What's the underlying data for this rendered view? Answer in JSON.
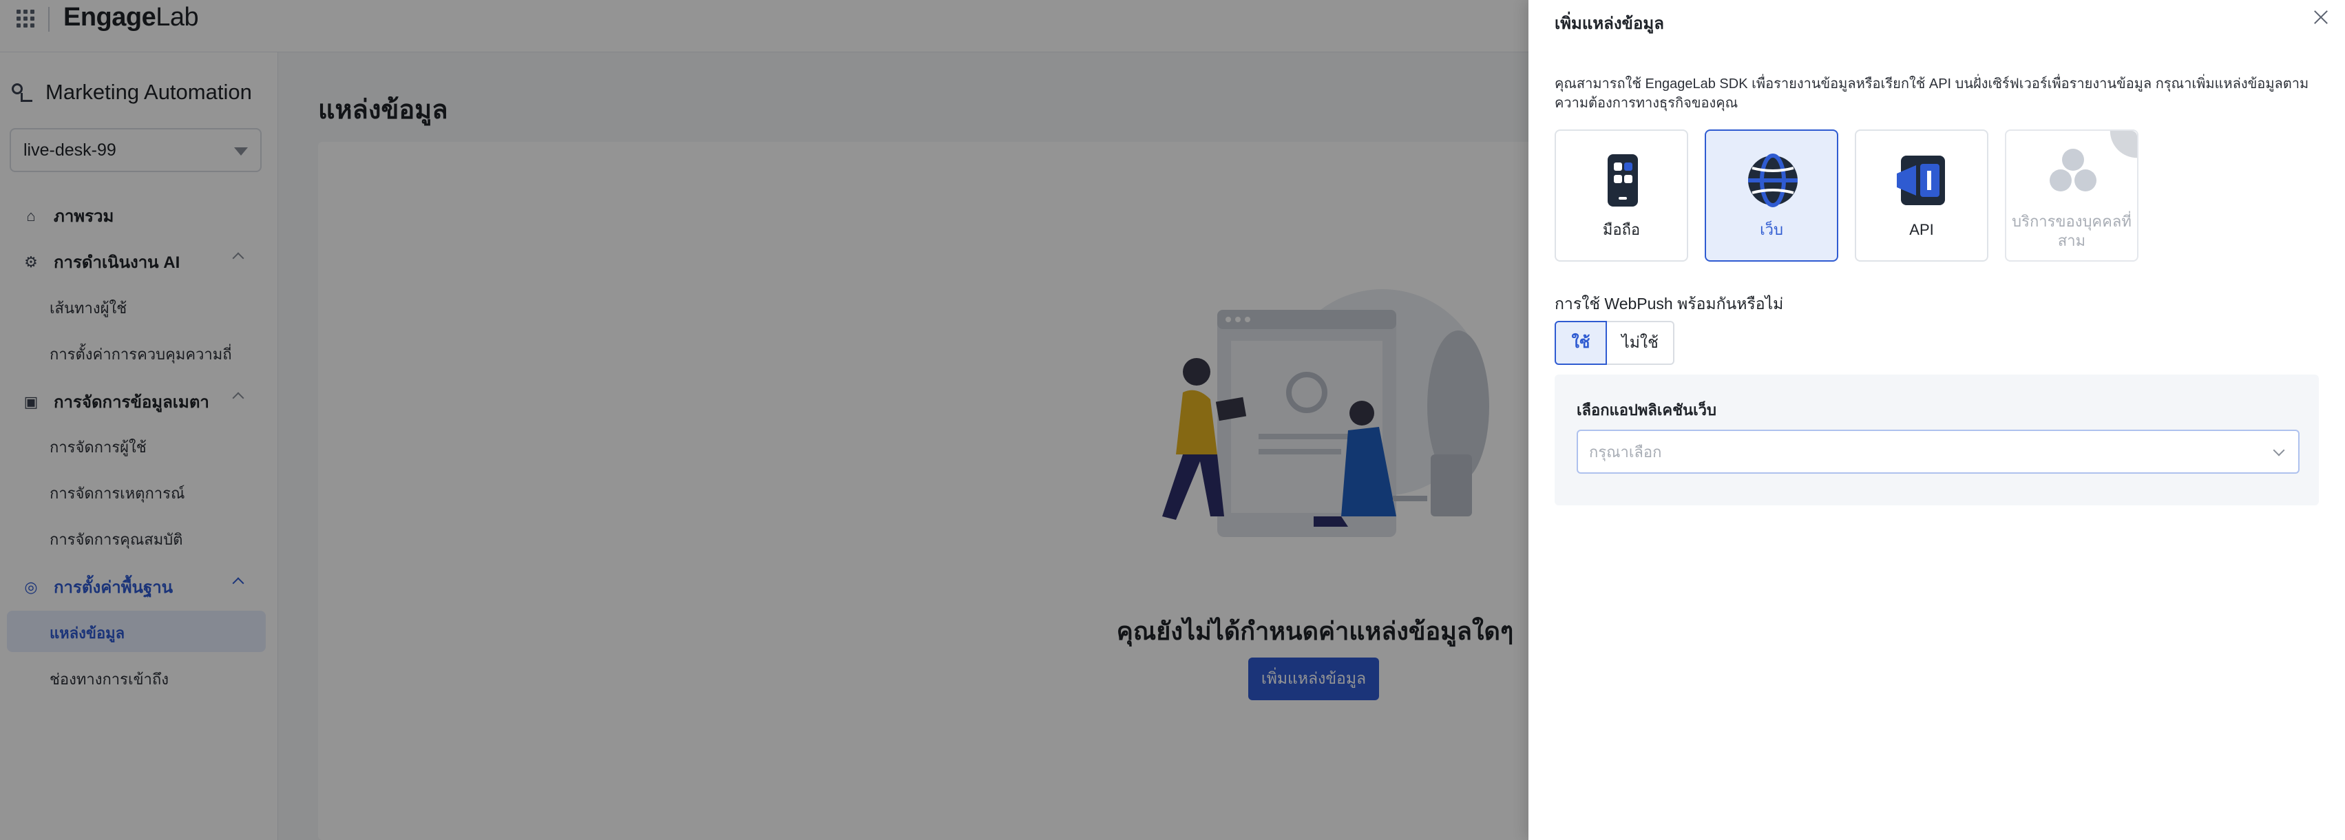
{
  "topbar": {
    "logo_main": "Engage",
    "logo_accent": "Lab"
  },
  "sidebar": {
    "module_title": "Marketing Automation",
    "workspace": "live-desk-99",
    "groups": [
      {
        "label": "ภาพรวม",
        "icon": "home-icon"
      },
      {
        "label": "การดำเนินงาน AI",
        "icon": "flow-icon"
      },
      {
        "label": "การจัดการข้อมูลเมตา",
        "icon": "data-icon"
      },
      {
        "label": "การตั้งค่าพื้นฐาน",
        "icon": "settings-icon"
      }
    ],
    "items": {
      "user_journey": "เส้นทางผู้ใช้",
      "frequency": "การตั้งค่าการควบคุมความถี่",
      "user_mgmt": "การจัดการผู้ใช้",
      "event_mgmt": "การจัดการเหตุการณ์",
      "attr_mgmt": "การจัดการคุณสมบัติ",
      "data_source": "แหล่งข้อมูล",
      "channel": "ช่องทางการเข้าถึง"
    }
  },
  "main": {
    "title": "แหล่งข้อมูล",
    "empty_text": "คุณยังไม่ได้กำหนดค่าแหล่งข้อมูลใดๆ",
    "add_button": "เพิ่มแหล่งข้อมูล"
  },
  "drawer": {
    "title": "เพิ่มแหล่งข้อมูล",
    "desc": "คุณสามารถใช้ EngageLab SDK เพื่อรายงานข้อมูลหรือเรียกใช้ API บนฝั่งเซิร์ฟเวอร์เพื่อรายงานข้อมูล กรุณาเพิ่มแหล่งข้อมูลตามความต้องการทางธุรกิจของคุณ",
    "sources": [
      {
        "label": "มือถือ",
        "icon": "mobile-icon",
        "state": "normal"
      },
      {
        "label": "เว็บ",
        "icon": "globe-icon",
        "state": "selected"
      },
      {
        "label": "API",
        "icon": "api-icon",
        "state": "normal"
      },
      {
        "label": "บริการของบุคคลที่สาม",
        "icon": "third-party-icon",
        "state": "disabled"
      }
    ],
    "webpush_question": "การใช้ WebPush พร้อมกันหรือไม่",
    "yes": "ใช้",
    "no": "ไม่ใช้",
    "app_label": "เลือกแอปพลิเคชันเว็บ",
    "app_placeholder": "กรุณาเลือก"
  },
  "colors": {
    "primary": "#2f5bd1",
    "selected_bg": "#e6edfb",
    "mask": "rgba(0,0,0,0.42)"
  }
}
